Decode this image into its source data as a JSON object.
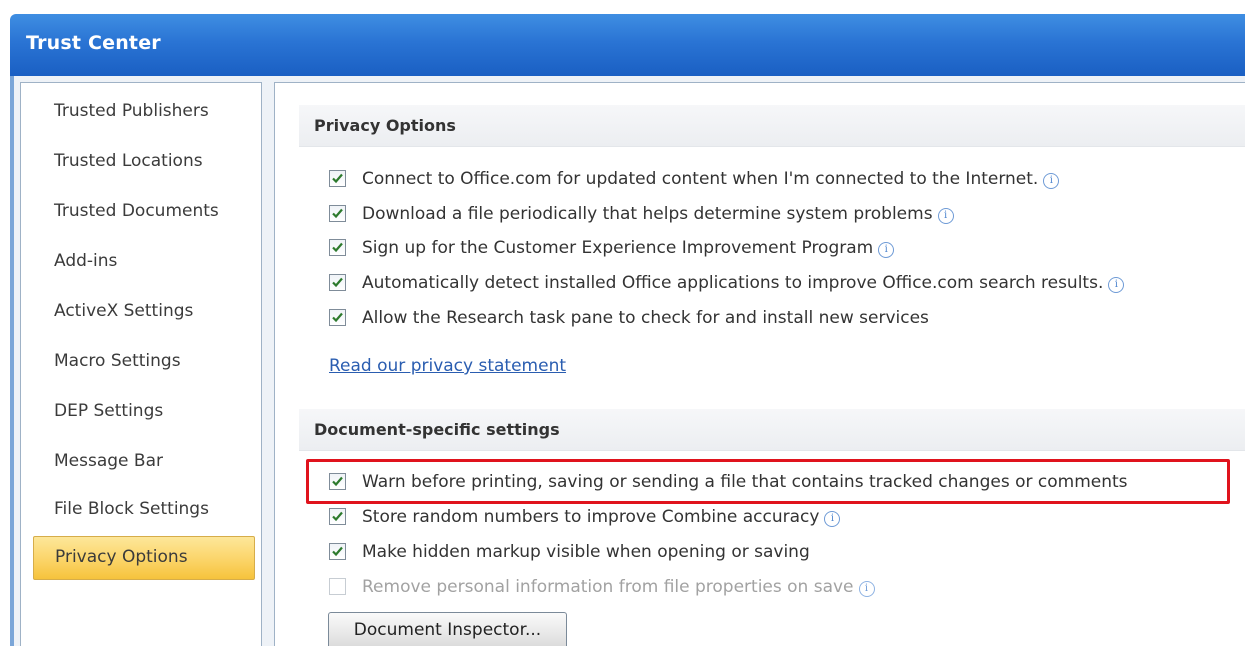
{
  "window": {
    "title": "Trust Center"
  },
  "sidebar": {
    "items": [
      {
        "label": "Trusted Publishers"
      },
      {
        "label": "Trusted Locations"
      },
      {
        "label": "Trusted Documents"
      },
      {
        "label": "Add-ins"
      },
      {
        "label": "ActiveX Settings"
      },
      {
        "label": "Macro Settings"
      },
      {
        "label": "DEP Settings"
      },
      {
        "label": "Message Bar"
      },
      {
        "label": "File Block Settings"
      },
      {
        "label": "Privacy Options",
        "selected": true
      }
    ]
  },
  "privacy_section": {
    "header": "Privacy Options",
    "options": [
      {
        "label": "Connect to Office.com for updated content when I'm connected to the Internet.",
        "checked": true,
        "info": true
      },
      {
        "label": "Download a file periodically that helps determine system problems",
        "checked": true,
        "info": true
      },
      {
        "label": "Sign up for the Customer Experience Improvement Program",
        "checked": true,
        "info": true
      },
      {
        "label": "Automatically detect installed Office applications to improve Office.com search results.",
        "checked": true,
        "info": true
      },
      {
        "label": "Allow the Research task pane to check for and install new services",
        "checked": true,
        "info": false
      }
    ],
    "link": "Read our privacy statement"
  },
  "document_section": {
    "header": "Document-specific settings",
    "options": [
      {
        "label": "Warn before printing, saving or sending a file that contains tracked changes or comments",
        "checked": true,
        "info": false,
        "highlighted": true
      },
      {
        "label": "Store random numbers to improve Combine accuracy",
        "checked": true,
        "info": true
      },
      {
        "label": "Make hidden markup visible when opening or saving",
        "checked": true,
        "info": false
      },
      {
        "label": "Remove personal information from file properties on save",
        "checked": false,
        "disabled": true,
        "info": true
      }
    ],
    "button": "Document Inspector..."
  },
  "icons": {
    "checkmark": "checkmark-icon",
    "info": "info-icon"
  },
  "colors": {
    "titlebar": "#2a74d4",
    "selected_nav": "#fbd468",
    "highlight_box": "#e0131d",
    "link": "#2a5db0"
  }
}
